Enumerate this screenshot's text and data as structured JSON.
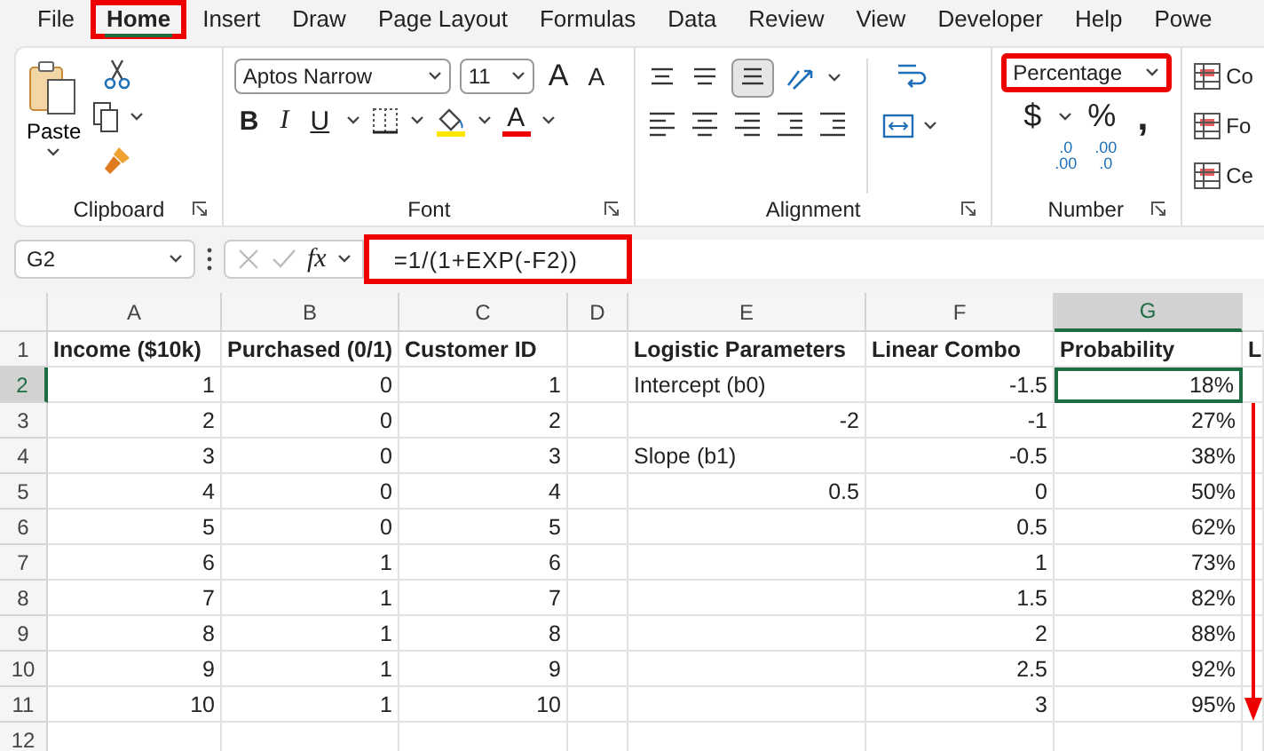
{
  "menu_tabs": [
    {
      "label": "File",
      "selected": false,
      "highlighted": false
    },
    {
      "label": "Home",
      "selected": true,
      "highlighted": true
    },
    {
      "label": "Insert",
      "selected": false,
      "highlighted": false
    },
    {
      "label": "Draw",
      "selected": false,
      "highlighted": false
    },
    {
      "label": "Page Layout",
      "selected": false,
      "highlighted": false
    },
    {
      "label": "Formulas",
      "selected": false,
      "highlighted": false
    },
    {
      "label": "Data",
      "selected": false,
      "highlighted": false
    },
    {
      "label": "Review",
      "selected": false,
      "highlighted": false
    },
    {
      "label": "View",
      "selected": false,
      "highlighted": false
    },
    {
      "label": "Developer",
      "selected": false,
      "highlighted": false
    },
    {
      "label": "Help",
      "selected": false,
      "highlighted": false
    },
    {
      "label": "Powe",
      "selected": false,
      "highlighted": false
    }
  ],
  "ribbon": {
    "clipboard": {
      "paste": "Paste",
      "label": "Clipboard"
    },
    "font": {
      "name": "Aptos Narrow",
      "size": "11",
      "grow": "A",
      "shrink": "A",
      "bold": "B",
      "italic": "I",
      "underline": "U",
      "color_letter": "A",
      "label": "Font"
    },
    "alignment": {
      "label": "Alignment"
    },
    "number": {
      "format": "Percentage",
      "highlighted": true,
      "currency": "$",
      "percent": "%",
      "comma": ",",
      "increase_decimal": [
        ".0",
        ".00"
      ],
      "decrease_decimal": [
        ".00",
        ".0"
      ],
      "label": "Number"
    },
    "styles": {
      "items": [
        "Co",
        "Fo",
        "Ce"
      ]
    }
  },
  "formula_bar": {
    "name_box": "G2",
    "fx": "fx",
    "formula": "=1/(1+EXP(-F2))",
    "highlighted": true
  },
  "sheet": {
    "columns": [
      {
        "label": "A",
        "selected": false
      },
      {
        "label": "B",
        "selected": false
      },
      {
        "label": "C",
        "selected": false
      },
      {
        "label": "D",
        "selected": false
      },
      {
        "label": "E",
        "selected": false
      },
      {
        "label": "F",
        "selected": false
      },
      {
        "label": "G",
        "selected": true
      }
    ],
    "down_arrow": true,
    "rows": [
      {
        "number": "1",
        "selected": false,
        "cells": [
          {
            "text": "Income ($10k)",
            "kind": "header"
          },
          {
            "text": "Purchased (0/1)",
            "kind": "header"
          },
          {
            "text": "Customer ID",
            "kind": "header"
          },
          null,
          {
            "text": "Logistic Parameters",
            "kind": "header"
          },
          {
            "text": "Linear Combo",
            "kind": "header"
          },
          {
            "text": "Probability",
            "kind": "header"
          },
          {
            "text": "L",
            "kind": "header"
          }
        ]
      },
      {
        "number": "2",
        "selected": true,
        "cells": [
          {
            "text": "1",
            "kind": "number"
          },
          {
            "text": "0",
            "kind": "number"
          },
          {
            "text": "1",
            "kind": "number"
          },
          null,
          {
            "text": "Intercept (b0)",
            "kind": "text"
          },
          {
            "text": "-1.5",
            "kind": "number"
          },
          {
            "text": "18%",
            "kind": "number"
          },
          null
        ]
      },
      {
        "number": "3",
        "selected": false,
        "cells": [
          {
            "text": "2",
            "kind": "number"
          },
          {
            "text": "0",
            "kind": "number"
          },
          {
            "text": "2",
            "kind": "number"
          },
          null,
          {
            "text": "-2",
            "kind": "number"
          },
          {
            "text": "-1",
            "kind": "number"
          },
          {
            "text": "27%",
            "kind": "number"
          },
          null
        ]
      },
      {
        "number": "4",
        "selected": false,
        "cells": [
          {
            "text": "3",
            "kind": "number"
          },
          {
            "text": "0",
            "kind": "number"
          },
          {
            "text": "3",
            "kind": "number"
          },
          null,
          {
            "text": "Slope (b1)",
            "kind": "text"
          },
          {
            "text": "-0.5",
            "kind": "number"
          },
          {
            "text": "38%",
            "kind": "number"
          },
          null
        ]
      },
      {
        "number": "5",
        "selected": false,
        "cells": [
          {
            "text": "4",
            "kind": "number"
          },
          {
            "text": "0",
            "kind": "number"
          },
          {
            "text": "4",
            "kind": "number"
          },
          null,
          {
            "text": "0.5",
            "kind": "number"
          },
          {
            "text": "0",
            "kind": "number"
          },
          {
            "text": "50%",
            "kind": "number"
          },
          null
        ]
      },
      {
        "number": "6",
        "selected": false,
        "cells": [
          {
            "text": "5",
            "kind": "number"
          },
          {
            "text": "0",
            "kind": "number"
          },
          {
            "text": "5",
            "kind": "number"
          },
          null,
          null,
          {
            "text": "0.5",
            "kind": "number"
          },
          {
            "text": "62%",
            "kind": "number"
          },
          null
        ]
      },
      {
        "number": "7",
        "selected": false,
        "cells": [
          {
            "text": "6",
            "kind": "number"
          },
          {
            "text": "1",
            "kind": "number"
          },
          {
            "text": "6",
            "kind": "number"
          },
          null,
          null,
          {
            "text": "1",
            "kind": "number"
          },
          {
            "text": "73%",
            "kind": "number"
          },
          null
        ]
      },
      {
        "number": "8",
        "selected": false,
        "cells": [
          {
            "text": "7",
            "kind": "number"
          },
          {
            "text": "1",
            "kind": "number"
          },
          {
            "text": "7",
            "kind": "number"
          },
          null,
          null,
          {
            "text": "1.5",
            "kind": "number"
          },
          {
            "text": "82%",
            "kind": "number"
          },
          null
        ]
      },
      {
        "number": "9",
        "selected": false,
        "cells": [
          {
            "text": "8",
            "kind": "number"
          },
          {
            "text": "1",
            "kind": "number"
          },
          {
            "text": "8",
            "kind": "number"
          },
          null,
          null,
          {
            "text": "2",
            "kind": "number"
          },
          {
            "text": "88%",
            "kind": "number"
          },
          null
        ]
      },
      {
        "number": "10",
        "selected": false,
        "cells": [
          {
            "text": "9",
            "kind": "number"
          },
          {
            "text": "1",
            "kind": "number"
          },
          {
            "text": "9",
            "kind": "number"
          },
          null,
          null,
          {
            "text": "2.5",
            "kind": "number"
          },
          {
            "text": "92%",
            "kind": "number"
          },
          null
        ]
      },
      {
        "number": "11",
        "selected": false,
        "cells": [
          {
            "text": "10",
            "kind": "number"
          },
          {
            "text": "1",
            "kind": "number"
          },
          {
            "text": "10",
            "kind": "number"
          },
          null,
          null,
          {
            "text": "3",
            "kind": "number"
          },
          {
            "text": "95%",
            "kind": "number"
          },
          null
        ]
      },
      {
        "number": "12",
        "selected": false,
        "cells": [
          null,
          null,
          null,
          null,
          null,
          null,
          null,
          null
        ]
      }
    ]
  }
}
